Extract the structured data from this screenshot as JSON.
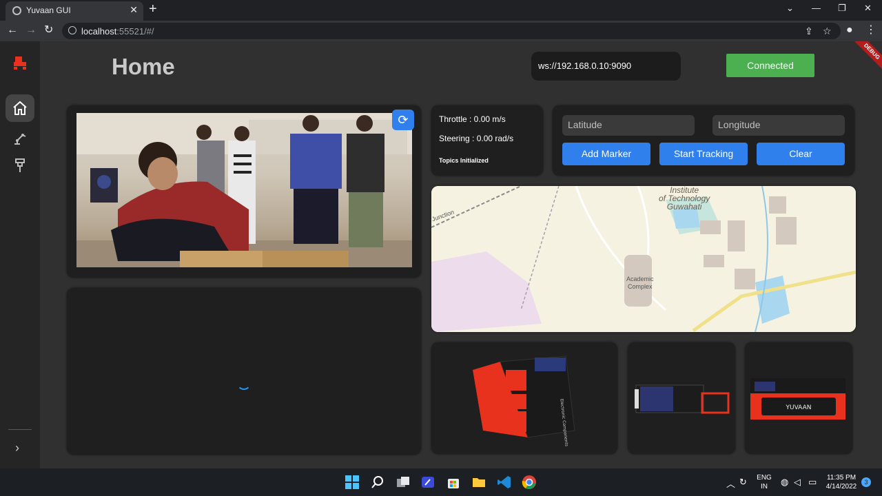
{
  "browser": {
    "tab_title": "Yuvaan GUI",
    "tab_close": "✕",
    "new_tab": "+",
    "url_host": "localhost",
    "url_rest": ":55521/#/",
    "win_controls": [
      "⌄",
      "—",
      "❐",
      "✕"
    ]
  },
  "app": {
    "page_title": "Home",
    "ws_url": "ws://192.168.0.10:9090",
    "connection_status": "Connected",
    "debug_banner": "DEBUG",
    "rail_expand": "›"
  },
  "telemetry": {
    "throttle": "Throttle : 0.00 m/s",
    "steering": "Steering : 0.00 rad/s",
    "status": "Topics Initialized"
  },
  "gps": {
    "latitude_placeholder": "Latitude",
    "longitude_placeholder": "Longitude",
    "add_marker": "Add Marker",
    "start_tracking": "Start Tracking",
    "clear": "Clear"
  },
  "map": {
    "label_institute": "Institute\nof Technology\nGuwahati",
    "label_complex": "Academic\nComplex",
    "label_junction": "Junction"
  },
  "camera": {
    "refresh_icon": "⟳"
  },
  "model_views": {
    "front_label": "Electronic Components",
    "logo_text": "YUVAAN"
  },
  "taskbar": {
    "lang_line1": "ENG",
    "lang_line2": "IN",
    "time": "11:35 PM",
    "date": "4/14/2022",
    "notifications": "3"
  },
  "colors": {
    "accent_blue": "#2f80ed",
    "connected_green": "#4caf50",
    "rover_red": "#e8321e",
    "debug_red": "#b71c1c"
  }
}
